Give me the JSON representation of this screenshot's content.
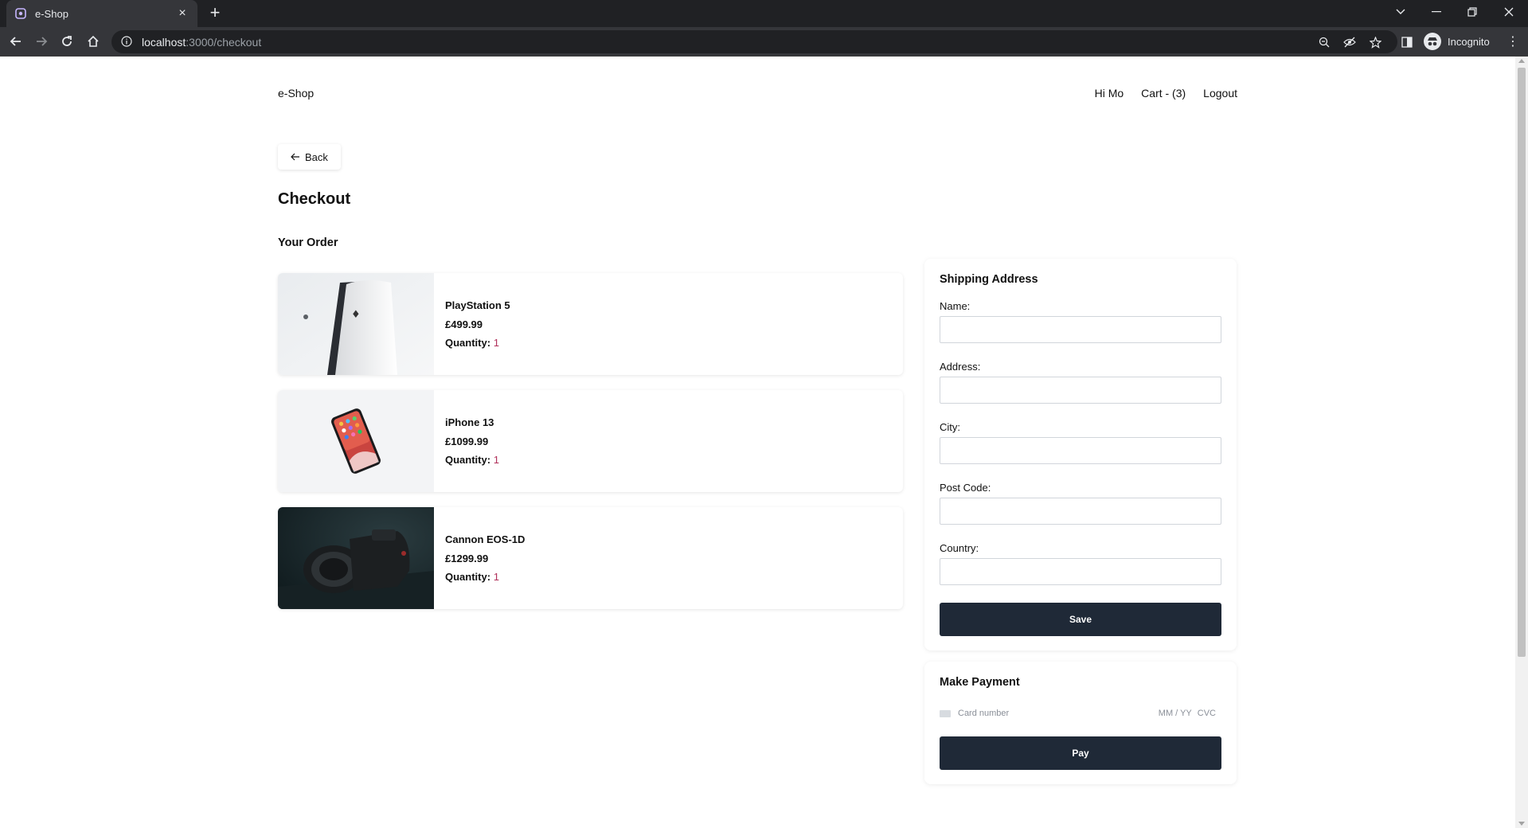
{
  "browser": {
    "tab_title": "e-Shop",
    "url_host": "localhost",
    "url_path": ":3000/checkout",
    "profile_label": "Incognito"
  },
  "header": {
    "brand": "e-Shop",
    "greeting": "Hi Mo",
    "cart": "Cart - (3)",
    "logout": "Logout"
  },
  "back_label": "Back",
  "page_title": "Checkout",
  "order": {
    "title": "Your Order",
    "quantity_label": "Quantity:",
    "items": [
      {
        "name": "PlayStation 5",
        "price": "£499.99",
        "quantity": "1",
        "image_icon": "playstation-image"
      },
      {
        "name": "iPhone 13",
        "price": "£1099.99",
        "quantity": "1",
        "image_icon": "iphone-image"
      },
      {
        "name": "Cannon EOS-1D",
        "price": "£1299.99",
        "quantity": "1",
        "image_icon": "camera-image"
      }
    ]
  },
  "shipping": {
    "title": "Shipping Address",
    "fields": [
      {
        "label": "Name:",
        "value": ""
      },
      {
        "label": "Address:",
        "value": ""
      },
      {
        "label": "City:",
        "value": ""
      },
      {
        "label": "Post Code:",
        "value": ""
      },
      {
        "label": "Country:",
        "value": ""
      }
    ],
    "save_label": "Save"
  },
  "payment": {
    "title": "Make Payment",
    "card_placeholder": "Card number",
    "expiry_placeholder": "MM / YY",
    "cvc_placeholder": "CVC",
    "pay_label": "Pay"
  },
  "colors": {
    "button_dark": "#1f2937",
    "quantity_value": "#b0305a"
  }
}
